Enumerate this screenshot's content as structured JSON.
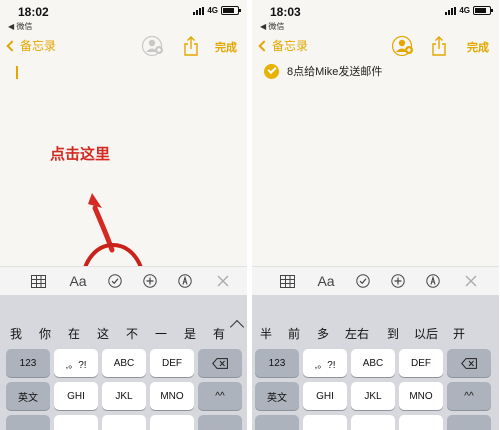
{
  "left": {
    "status": {
      "time": "18:02",
      "back_app": "◀ 微信",
      "network": "4G"
    },
    "nav": {
      "back_label": "备忘录",
      "done_label": "完成"
    },
    "annotation": "点击这里",
    "candidates": [
      "我",
      "你",
      "在",
      "这",
      "不",
      "一",
      "是",
      "有"
    ],
    "keys_row1": [
      "123",
      ",。?!",
      "ABC",
      "DEF"
    ],
    "keys_row2": [
      "英文",
      "GHI",
      "JKL",
      "MNO",
      "^^"
    ]
  },
  "right": {
    "status": {
      "time": "18:03",
      "back_app": "◀ 微信",
      "network": "4G"
    },
    "nav": {
      "back_label": "备忘录",
      "done_label": "完成"
    },
    "checklist_item": "8点给Mike发送邮件",
    "candidates": [
      "半",
      "前",
      "多",
      "左右",
      "到",
      "以后",
      "开"
    ],
    "keys_row1": [
      "123",
      ",。?!",
      "ABC",
      "DEF"
    ],
    "keys_row2": [
      "英文",
      "GHI",
      "JKL",
      "MNO",
      "^^"
    ]
  },
  "toolbar": {
    "format_label": "Aa"
  },
  "colors": {
    "accent": "#e3a700",
    "annotation": "#d42a22",
    "checked": "#e8b200"
  }
}
